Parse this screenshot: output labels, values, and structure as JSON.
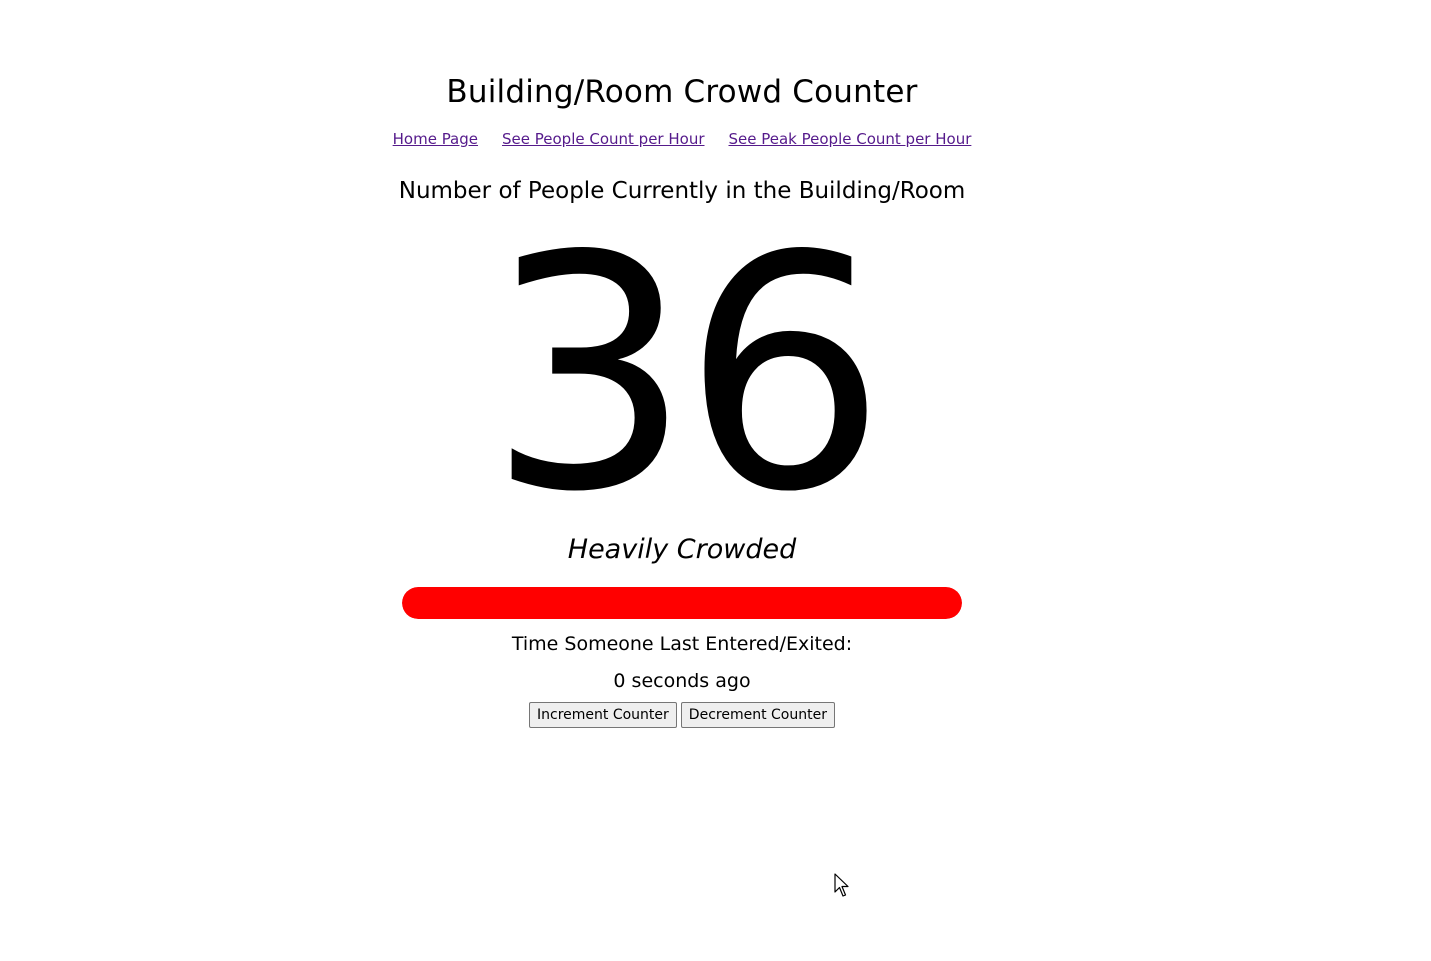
{
  "header": {
    "title": "Building/Room Crowd Counter"
  },
  "nav": {
    "links": [
      {
        "label": "Home Page"
      },
      {
        "label": "See People Count per Hour"
      },
      {
        "label": "See Peak People Count per Hour"
      }
    ]
  },
  "main": {
    "subtitle": "Number of People Currently in the Building/Room",
    "count": "36",
    "status": "Heavily Crowded",
    "crowd_level": 1.0,
    "crowd_color": "#ff0000",
    "last_activity_label": "Time Someone Last Entered/Exited:",
    "last_activity_value": "0 seconds ago"
  },
  "controls": {
    "increment_label": "Increment Counter",
    "decrement_label": "Decrement Counter"
  },
  "colors": {
    "link": "#551a8b",
    "bar": "#ff0000"
  },
  "icons": {
    "cursor": "mouse-pointer-icon"
  }
}
